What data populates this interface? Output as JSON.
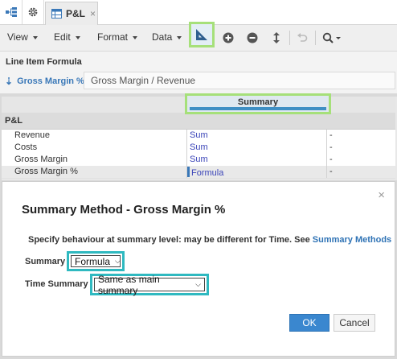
{
  "tabbar": {
    "active_tab_label": "P&L",
    "close_glyph": "×"
  },
  "toolbar": {
    "menus": [
      "View",
      "Edit",
      "Format",
      "Data"
    ],
    "icons": [
      "summary-icon",
      "add-icon",
      "remove-icon",
      "resize-icon",
      "undo-icon",
      "search-icon"
    ]
  },
  "formula": {
    "section_title": "Line Item Formula",
    "line_item_name": "Gross Margin %",
    "expression": "Gross Margin / Revenue"
  },
  "grid": {
    "column_header": "Summary",
    "section_label": "P&L",
    "rows": [
      {
        "name": "Revenue",
        "summary": "Sum",
        "extra": "-"
      },
      {
        "name": "Costs",
        "summary": "Sum",
        "extra": "-"
      },
      {
        "name": "Gross Margin",
        "summary": "Sum",
        "extra": "-"
      },
      {
        "name": "Gross Margin %",
        "summary": "Formula",
        "extra": "-"
      }
    ]
  },
  "dialog": {
    "close_glyph": "×",
    "title": "Summary Method - Gross Margin %",
    "description": "Specify behaviour at summary level: may be different for Time. See",
    "link_text": "Summary Methods",
    "summary_label": "Summary",
    "summary_value": "Formula",
    "time_summary_label": "Time Summary",
    "time_summary_value": "Same as main summary",
    "ok_label": "OK",
    "cancel_label": "Cancel"
  },
  "colors": {
    "accent_blue": "#3a87cf",
    "highlight_green": "#a6e07a",
    "highlight_teal": "#2fb9c0"
  }
}
